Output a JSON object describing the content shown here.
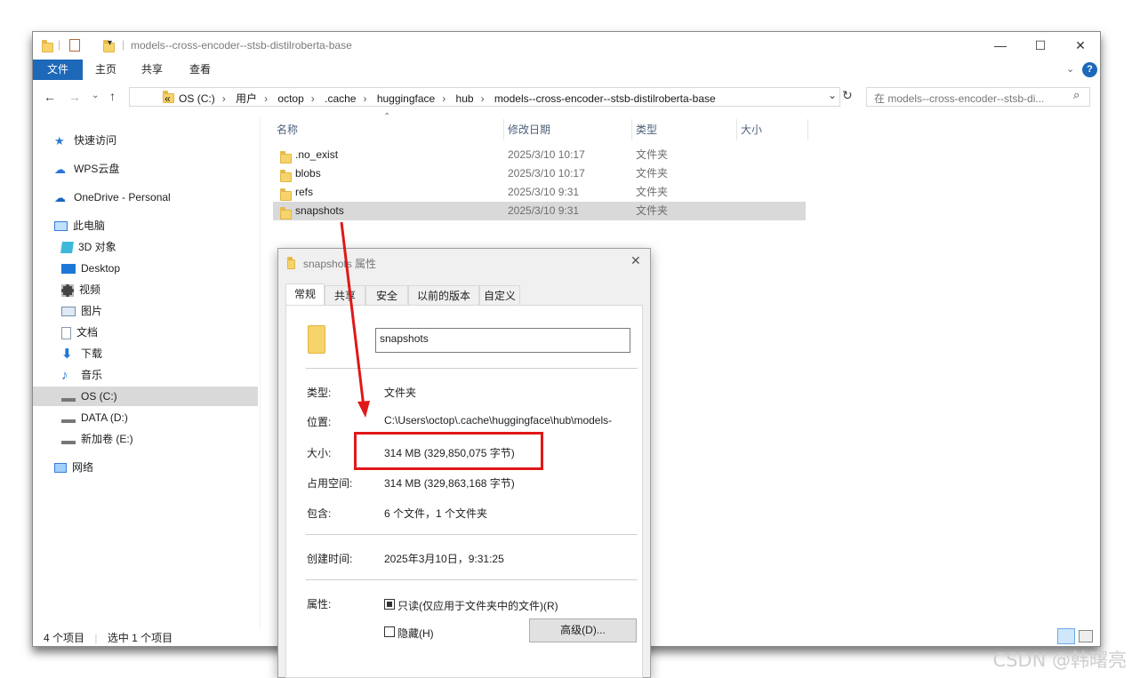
{
  "window": {
    "title": "models--cross-encoder--stsb-distilroberta-base"
  },
  "ribbon": {
    "tabs": [
      "文件",
      "主页",
      "共享",
      "查看"
    ]
  },
  "address": {
    "prefix": "«",
    "crumbs": [
      "OS (C:)",
      "用户",
      "octop",
      ".cache",
      "huggingface",
      "hub",
      "models--cross-encoder--stsb-distilroberta-base"
    ],
    "search_placeholder": "在 models--cross-encoder--stsb-di..."
  },
  "sidebar": {
    "items": [
      {
        "label": "快速访问",
        "icon": "star-icon"
      },
      {
        "label": "WPS云盘",
        "icon": "cloud-icon"
      },
      {
        "label": "OneDrive - Personal",
        "icon": "cloud-icon"
      },
      {
        "label": "此电脑",
        "icon": "computer-icon"
      },
      {
        "label": "3D 对象",
        "icon": "cube-icon"
      },
      {
        "label": "Desktop",
        "icon": "desktop-icon"
      },
      {
        "label": "视频",
        "icon": "video-icon"
      },
      {
        "label": "图片",
        "icon": "pictures-icon"
      },
      {
        "label": "文档",
        "icon": "document-icon"
      },
      {
        "label": "下载",
        "icon": "download-icon"
      },
      {
        "label": "音乐",
        "icon": "music-icon"
      },
      {
        "label": "OS (C:)",
        "icon": "drive-icon"
      },
      {
        "label": "DATA (D:)",
        "icon": "drive-icon"
      },
      {
        "label": "新加卷 (E:)",
        "icon": "drive-icon"
      },
      {
        "label": "网络",
        "icon": "network-icon"
      }
    ]
  },
  "list": {
    "columns": [
      "名称",
      "修改日期",
      "类型",
      "大小"
    ],
    "rows": [
      {
        "name": ".no_exist",
        "date": "2025/3/10 10:17",
        "type": "文件夹"
      },
      {
        "name": "blobs",
        "date": "2025/3/10 10:17",
        "type": "文件夹"
      },
      {
        "name": "refs",
        "date": "2025/3/10 9:31",
        "type": "文件夹"
      },
      {
        "name": "snapshots",
        "date": "2025/3/10 9:31",
        "type": "文件夹"
      }
    ]
  },
  "status": {
    "count": "4 个项目",
    "selected": "选中 1 个项目"
  },
  "dialog": {
    "title": "snapshots 属性",
    "tabs": [
      "常规",
      "共享",
      "安全",
      "以前的版本",
      "自定义"
    ],
    "name_value": "snapshots",
    "type_label": "类型:",
    "type_value": "文件夹",
    "location_label": "位置:",
    "location_value": "C:\\Users\\octop\\.cache\\huggingface\\hub\\models-",
    "size_label": "大小:",
    "size_value": "314 MB (329,850,075 字节)",
    "disk_label": "占用空间:",
    "disk_value": "314 MB (329,863,168 字节)",
    "contains_label": "包含:",
    "contains_value": "6 个文件，1 个文件夹",
    "created_label": "创建时间:",
    "created_value": "2025年3月10日，9:31:25",
    "attr_label": "属性:",
    "readonly_label": "只读(仅应用于文件夹中的文件)(R)",
    "hidden_label": "隐藏(H)",
    "advanced_button": "高级(D)..."
  },
  "watermark": "CSDN @韩曙亮",
  "colors": {
    "accent": "#1d68b8",
    "highlight": "#e01818"
  }
}
